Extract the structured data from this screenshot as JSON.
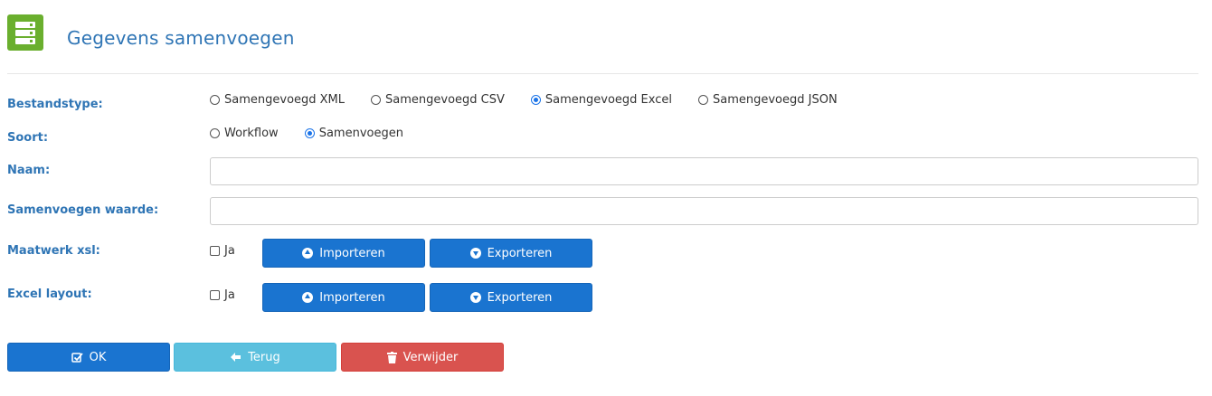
{
  "header": {
    "title": "Gegevens samenvoegen",
    "icon": "server-stack-icon"
  },
  "form": {
    "bestandstype": {
      "label": "Bestandstype:",
      "options": [
        "Samengevoegd XML",
        "Samengevoegd CSV",
        "Samengevoegd Excel",
        "Samengevoegd JSON"
      ],
      "selected": "Samengevoegd Excel"
    },
    "soort": {
      "label": "Soort:",
      "options": [
        "Workflow",
        "Samenvoegen"
      ],
      "selected": "Samenvoegen"
    },
    "naam": {
      "label": "Naam:",
      "value": ""
    },
    "samenvoegen_waarde": {
      "label": "Samenvoegen waarde:",
      "value": ""
    },
    "maatwerk_xsl": {
      "label": "Maatwerk xsl:",
      "checkbox_label": "Ja",
      "checked": false,
      "import_label": "Importeren",
      "export_label": "Exporteren"
    },
    "excel_layout": {
      "label": "Excel layout:",
      "checkbox_label": "Ja",
      "checked": false,
      "import_label": "Importeren",
      "export_label": "Exporteren"
    }
  },
  "actions": {
    "ok_label": "OK",
    "back_label": "Terug",
    "delete_label": "Verwijder"
  },
  "colors": {
    "accent": "#2f75b5",
    "primary_button": "#1a74d0",
    "info_button": "#5bc0de",
    "danger_button": "#d9534f",
    "header_icon": "#6aaf2e"
  }
}
